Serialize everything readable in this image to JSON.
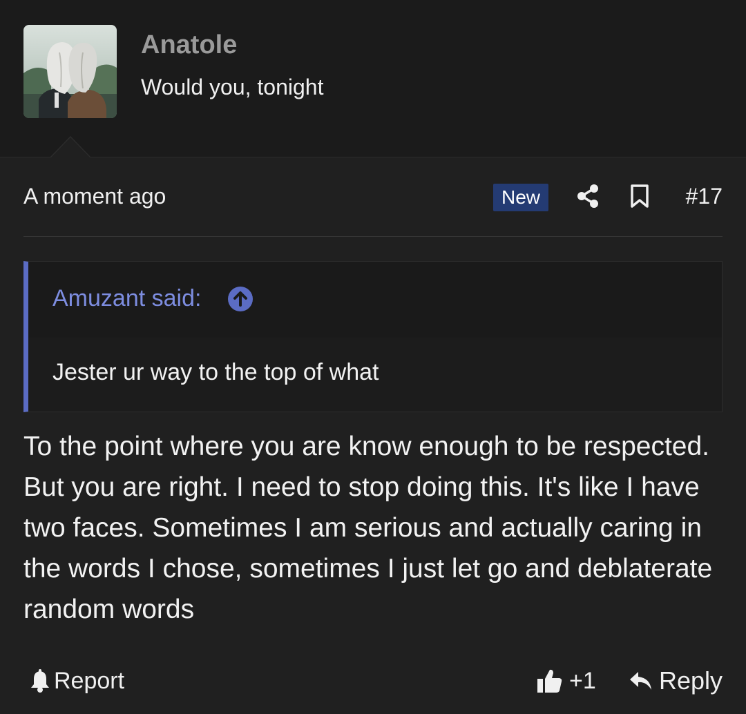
{
  "user": {
    "name": "Anatole",
    "title": "Would you, tonight"
  },
  "post": {
    "timestamp": "A moment ago",
    "badge": "New",
    "number": "#17",
    "message": "To the point where you are know enough to be respected. But you are right. I need to stop doing this. It's like I have two faces. Sometimes I am serious and actually caring in the words I chose, sometimes I just let go and deblaterate random words"
  },
  "quote": {
    "author": "Amuzant said:",
    "text": "Jester ur way to the top of what"
  },
  "actions": {
    "report": "Report",
    "like_count": "+1",
    "reply": "Reply"
  },
  "colors": {
    "background": "#202020",
    "header_background": "#1b1b1b",
    "accent": "#5b6cc4",
    "badge": "#243b73"
  },
  "icons": [
    "share-icon",
    "bookmark-icon",
    "arrow-up-circle-icon",
    "bell-icon",
    "thumbs-up-icon",
    "reply-arrow-icon"
  ]
}
